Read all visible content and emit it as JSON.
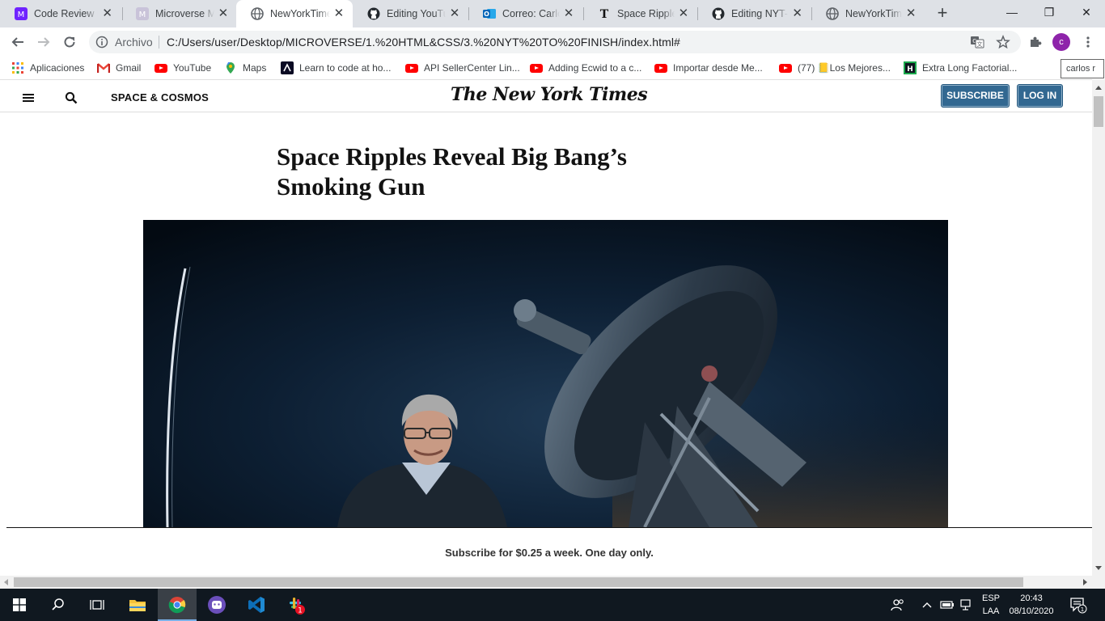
{
  "browser": {
    "tabs": [
      {
        "title": "Code Review R",
        "icon": "microverse-icon",
        "active": false
      },
      {
        "title": "Microverse Ma",
        "icon": "microverse-icon",
        "active": false
      },
      {
        "title": "NewYorkTimes",
        "icon": "globe-icon",
        "active": true
      },
      {
        "title": "Editing YouTub",
        "icon": "github-icon",
        "active": false
      },
      {
        "title": "Correo: Carlos",
        "icon": "outlook-icon",
        "active": false
      },
      {
        "title": "Space Ripples",
        "icon": "nyt-icon",
        "active": false
      },
      {
        "title": "Editing NYT-h",
        "icon": "github-icon",
        "active": false
      },
      {
        "title": "NewYorkTimes",
        "icon": "globe-icon",
        "active": false
      }
    ],
    "omnibox": {
      "chip": "Archivo",
      "url": "C:/Users/user/Desktop/MICROVERSE/1.%20HTML&CSS/3.%20NYT%20TO%20FINISH/index.html#"
    },
    "profile_initial": "c",
    "profile_tooltip": "carlos r",
    "bookmarks": [
      {
        "label": "Aplicaciones",
        "icon": "apps-grid-icon"
      },
      {
        "label": "Gmail",
        "icon": "gmail-icon"
      },
      {
        "label": "YouTube",
        "icon": "youtube-icon"
      },
      {
        "label": "Maps",
        "icon": "maps-icon"
      },
      {
        "label": "Learn to code at ho...",
        "icon": "freecodecamp-icon"
      },
      {
        "label": "API SellerCenter Lin...",
        "icon": "youtube-icon"
      },
      {
        "label": "Adding Ecwid to a c...",
        "icon": "youtube-icon"
      },
      {
        "label": "Importar desde Me...",
        "icon": "youtube-icon"
      },
      {
        "label": "(77) 📒Los Mejores...",
        "icon": "youtube-icon"
      },
      {
        "label": "Extra Long Factorial...",
        "icon": "hackerrank-icon"
      }
    ]
  },
  "page": {
    "section": "SPACE & COSMOS",
    "logo": "The New York Times",
    "subscribe_label": "SUBSCRIBE",
    "login_label": "LOG IN",
    "headline": "Space Ripples Reveal Big Bang’s Smoking Gun",
    "banner_text": "Subscribe for $0.25 a week. One day only."
  },
  "taskbar": {
    "language_line1": "ESP",
    "language_line2": "LAA",
    "time": "20:43",
    "date": "08/10/2020",
    "notification_count": "1",
    "slack_badge": "1"
  }
}
